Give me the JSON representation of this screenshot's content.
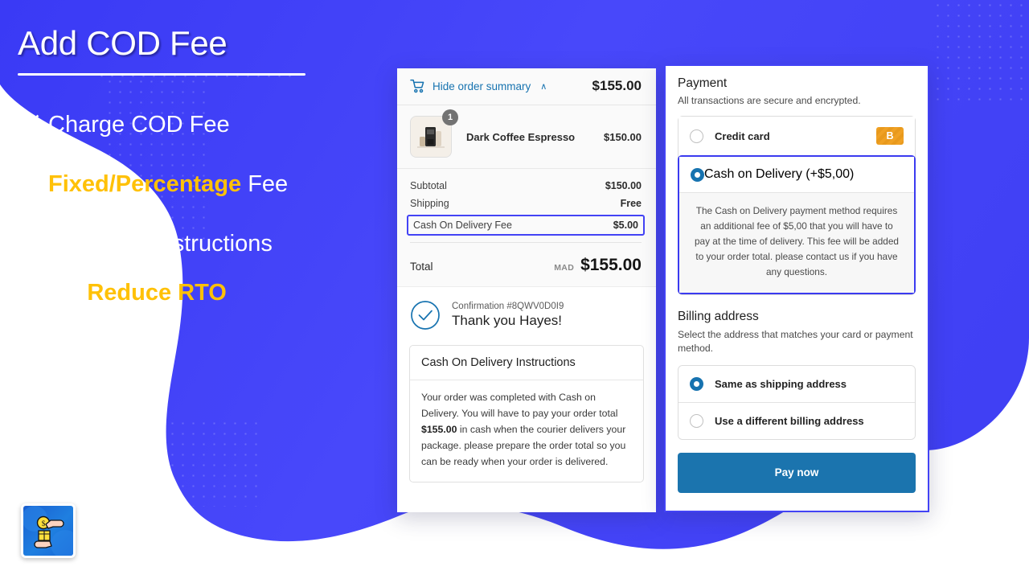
{
  "theme": {
    "brand_blue": "#4343f5",
    "accent_yellow": "#FFC107",
    "shopify_link_blue": "#1773b0",
    "pay_button_blue": "#1b74ae",
    "highlight_border": "#3b3bf0"
  },
  "promo": {
    "title": "Add COD Fee",
    "features": [
      {
        "icon": "checkbox-checked-icon",
        "text_plain": "Charge COD Fee",
        "highlight": "",
        "text_after": ""
      },
      {
        "icon": "checkbox-checked-icon",
        "text_plain": "",
        "highlight": "Fixed/Percentage",
        "text_after": " Fee"
      },
      {
        "icon": "checkbox-checked-icon",
        "text_plain": "Add COD instructions",
        "highlight": "",
        "text_after": ""
      }
    ],
    "closing_amp": "&",
    "closing_highlight": "Reduce RTO",
    "logo_name": "cod-app-logo"
  },
  "order_summary": {
    "cart_icon": "shopping-cart-icon",
    "toggle_label": "Hide order summary",
    "toggle_caret": "∧",
    "header_total": "$155.00",
    "line_items": [
      {
        "name": "Dark Coffee Espresso",
        "qty": "1",
        "price": "$150.00",
        "thumb": "espresso-machine-thumbnail"
      }
    ],
    "totals": [
      {
        "label": "Subtotal",
        "value": "$150.00",
        "highlighted": false
      },
      {
        "label": "Shipping",
        "value": "Free",
        "highlighted": false
      },
      {
        "label": "Cash On Delivery Fee",
        "value": "$5.00",
        "highlighted": true
      }
    ],
    "grand_total": {
      "label": "Total",
      "currency": "MAD",
      "value": "$155.00"
    }
  },
  "confirmation": {
    "check_icon": "check-circle-icon",
    "order_number": "Confirmation #8QWV0D0I9",
    "thank_you": "Thank you Hayes!",
    "instructions_title": "Cash On Delivery Instructions",
    "instructions_body_1": "Your order was completed with Cash on Delivery. You will have to pay your order total ",
    "instructions_amount": "$155.00",
    "instructions_body_2": " in cash when the courier delivers your package. please prepare the order total so you can be ready when your order is delivered."
  },
  "payment": {
    "title": "Payment",
    "subtitle": "All transactions are secure and encrypted.",
    "methods": [
      {
        "label": "Credit card",
        "selected": false,
        "badge": "B",
        "badge_name": "bogus-gateway-badge"
      },
      {
        "label": "Cash on Delivery (+$5,00)",
        "selected": true,
        "badge": "",
        "badge_name": ""
      }
    ],
    "cod_note": "The Cash on Delivery payment method requires an additional fee of $5,00 that you will have to pay at the time of delivery. This fee will be added to your order total. please contact us if you have any questions."
  },
  "billing": {
    "title": "Billing address",
    "subtitle": "Select the address that matches your card or payment method.",
    "options": [
      {
        "label": "Same as shipping address",
        "selected": true
      },
      {
        "label": "Use a different billing address",
        "selected": false
      }
    ],
    "pay_button": "Pay now"
  }
}
